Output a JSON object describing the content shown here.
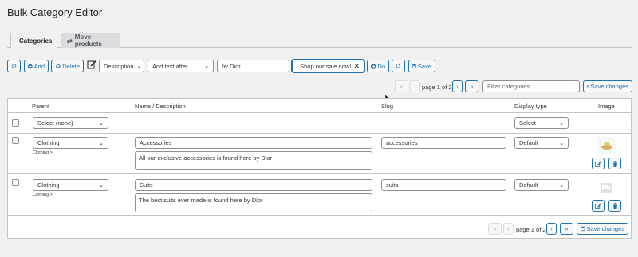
{
  "page": {
    "title": "Bulk Category Editor"
  },
  "tabs": [
    {
      "label": "Categories",
      "icon": "list-icon"
    },
    {
      "label": "Move products",
      "icon": "swap-icon"
    }
  ],
  "toolbar": {
    "add_label": "Add",
    "delete_label": "Delete",
    "field_select": "Description",
    "action_select": "Add text after",
    "text_value": "by Dior",
    "second_text_value": ". Shop our sale now!",
    "do_label": "Do",
    "save_label": "Save"
  },
  "pagination": {
    "page_text": "page 1 of 2",
    "filter_placeholder": "Filter categories",
    "save_changes_label": "Save changes"
  },
  "table": {
    "headers": {
      "parent": "Parent",
      "name": "Name / Description",
      "slug": "Slug",
      "display": "Display type",
      "image": "Image"
    },
    "filter_row": {
      "parent": "Select (none)",
      "display": "Select"
    },
    "rows": [
      {
        "parent": "Clothing",
        "breadcrumb": "Clothing >",
        "name": "Accessories",
        "description": "All our exclusive accessories is found here by Dior",
        "slug": "accessories",
        "display": "Default"
      },
      {
        "parent": "Clothing",
        "breadcrumb": "Clothing >",
        "name": "Suits",
        "description": "The best suits ever made is found here by Dior",
        "slug": "suits",
        "display": "Default"
      }
    ]
  },
  "colors": {
    "accent": "#2271b1",
    "background": "#f0f0f1",
    "border": "#c3c4c7"
  }
}
